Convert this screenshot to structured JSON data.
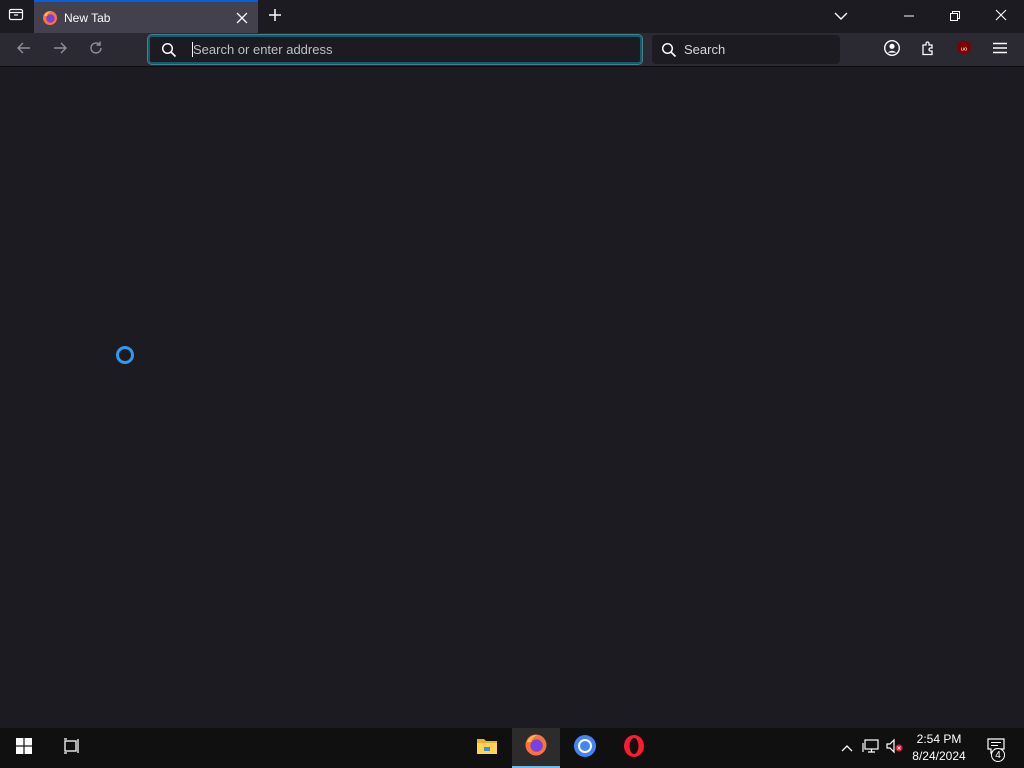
{
  "browser": {
    "tab": {
      "title": "New Tab"
    },
    "urlbar": {
      "placeholder": "Search or enter address"
    },
    "searchbar": {
      "placeholder": "Search"
    },
    "accent_color": "#0060df",
    "spinner_color": "#2d9cf0"
  },
  "taskbar": {
    "apps": [
      {
        "name": "File Explorer",
        "icon": "folder-icon"
      },
      {
        "name": "Firefox",
        "icon": "firefox-icon",
        "active": true
      },
      {
        "name": "Chrome",
        "icon": "chrome-icon"
      },
      {
        "name": "Opera",
        "icon": "opera-icon"
      }
    ],
    "clock": {
      "time": "2:54 PM",
      "date": "8/24/2024"
    },
    "notifications_count": "4"
  }
}
